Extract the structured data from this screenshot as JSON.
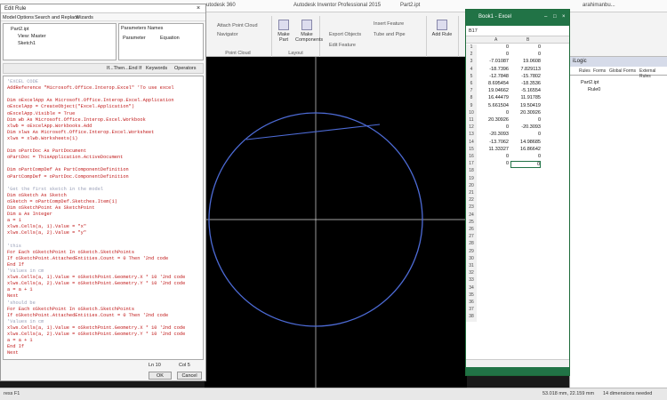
{
  "inventor": {
    "title": "Autodesk Inventor Professional 2015",
    "file": "Part2.ipt",
    "tab_fragment": "utodesk 360",
    "user": "arahimanbu...",
    "ribbon": {
      "buttons": [
        {
          "label": "Make Part"
        },
        {
          "label": "Make Components"
        },
        {
          "label": "Add Rule"
        }
      ],
      "small_items": [
        "Attach Point Cloud",
        "Navigator",
        "Point Cloud",
        "Export Objects",
        "Tube and Pipe",
        "Insert Feature",
        "Edit Feature"
      ],
      "groups": [
        "Point Cloud",
        "Layout",
        "iLogic"
      ]
    },
    "status": {
      "left": "ress F1",
      "coords": "53.018 mm, 22.159 mm",
      "dims": "14 dimensions needed"
    }
  },
  "ilogic_panel": {
    "title": "iLogic",
    "tabs": [
      "Rules",
      "Forms",
      "Global Forms",
      "External Rules"
    ],
    "tree": [
      "Part2.ipt",
      "Rule0"
    ]
  },
  "excel": {
    "title": "Book1 - Excel",
    "name_box": "B17",
    "columns": [
      "A",
      "B"
    ],
    "rows": [
      [
        "0",
        "0"
      ],
      [
        "0",
        "0"
      ],
      [
        "-7.01087",
        "19.0608"
      ],
      [
        "-18.7396",
        "7.829113"
      ],
      [
        "-12.7848",
        "-15.7802"
      ],
      [
        "8.695454",
        "-18.3536"
      ],
      [
        "19.04662",
        "-5.16554"
      ],
      [
        "16.44479",
        "11.91785"
      ],
      [
        "5.661504",
        "19.50419"
      ],
      [
        "0",
        "20.30926"
      ],
      [
        "20.30926",
        "0"
      ],
      [
        "0",
        "-20.3093"
      ],
      [
        "-20.3093",
        "0"
      ],
      [
        "-13.7062",
        "14.98685"
      ],
      [
        "11.33327",
        "16.86642"
      ],
      [
        "0",
        "0"
      ],
      [
        "0",
        "0"
      ]
    ],
    "extra_rows": [
      "18",
      "19",
      "20",
      "21",
      "22",
      "23",
      "24",
      "25",
      "26",
      "27",
      "28",
      "29",
      "30",
      "31",
      "32",
      "33",
      "34",
      "35",
      "36",
      "37",
      "38"
    ]
  },
  "editor": {
    "title": "Edit Rule",
    "menu": [
      "Model",
      "Options",
      "Search and Replace",
      "Wizards"
    ],
    "tree": [
      "Part2.ipt",
      "View: Master",
      "Sketch1"
    ],
    "params_tabs": [
      "Parameters",
      "Names"
    ],
    "params_cols": [
      "Parameter",
      "Equation"
    ],
    "toolbar": [
      "If...Then...End If",
      "Keywords",
      "Operators"
    ],
    "code": [
      {
        "t": "'EXCEL CODE",
        "c": "cm"
      },
      {
        "t": "AddReference \"Microsoft.Office.Interop.Excel\" 'To use excel",
        "c": "kw"
      },
      {
        "t": "",
        "c": "tx"
      },
      {
        "t": "Dim oExcelApp As Microsoft.Office.Interop.Excel.Application",
        "c": "kw"
      },
      {
        "t": "oExcelApp = CreateObject(\"Excel.Application\")",
        "c": "kw"
      },
      {
        "t": "oExcelApp.Visible = True",
        "c": "kw"
      },
      {
        "t": "Dim wb As Microsoft.Office.Interop.Excel.Workbook",
        "c": "kw"
      },
      {
        "t": "xlwb = oExcelApp.Workbooks.Add",
        "c": "kw"
      },
      {
        "t": "Dim xlws As Microsoft.Office.Interop.Excel.Worksheet",
        "c": "kw"
      },
      {
        "t": "xlws = xlwb.Worksheets(1)",
        "c": "kw"
      },
      {
        "t": "",
        "c": "tx"
      },
      {
        "t": "Dim oPartDoc As PartDocument",
        "c": "kw"
      },
      {
        "t": "oPartDoc = ThisApplication.ActiveDocument",
        "c": "kw"
      },
      {
        "t": "",
        "c": "tx"
      },
      {
        "t": "Dim oPartCompDef As PartComponentDefinition",
        "c": "kw"
      },
      {
        "t": "oPartCompDef = oPartDoc.ComponentDefinition",
        "c": "kw"
      },
      {
        "t": "",
        "c": "tx"
      },
      {
        "t": "'Get the first sketch in the model",
        "c": "cm"
      },
      {
        "t": "Dim oSketch As Sketch",
        "c": "kw"
      },
      {
        "t": "oSketch = oPartCompDef.Sketches.Item(1)",
        "c": "kw"
      },
      {
        "t": "Dim oSketchPoint As SketchPoint",
        "c": "kw"
      },
      {
        "t": "Dim a As Integer",
        "c": "kw"
      },
      {
        "t": "a = 1",
        "c": "kw"
      },
      {
        "t": "xlws.Cells(a, 1).Value = \"x\"",
        "c": "kw"
      },
      {
        "t": "xlws.Cells(a, 2).Value = \"y\"",
        "c": "kw"
      },
      {
        "t": "",
        "c": "tx"
      },
      {
        "t": "'this",
        "c": "cm"
      },
      {
        "t": "For Each oSketchPoint In oSketch.SketchPoints",
        "c": "kw"
      },
      {
        "t": "If oSketchPoint.AttachedEntities.Count = 0 Then '2nd code",
        "c": "kw"
      },
      {
        "t": "End If",
        "c": "kw"
      },
      {
        "t": "'Values in cm",
        "c": "cm"
      },
      {
        "t": "xlws.Cells(a, 1).Value = oSketchPoint.Geometry.X * 10 '2nd code",
        "c": "kw"
      },
      {
        "t": "xlws.Cells(a, 2).Value = oSketchPoint.Geometry.Y * 10 '2nd code",
        "c": "kw"
      },
      {
        "t": "a = a + 1",
        "c": "kw"
      },
      {
        "t": "Next",
        "c": "kw"
      },
      {
        "t": "'should be",
        "c": "cm"
      },
      {
        "t": "For Each oSketchPoint In oSketch.SketchPoints",
        "c": "kw"
      },
      {
        "t": "If oSketchPoint.AttachedEntities.Count = 0 Then '2nd code",
        "c": "kw"
      },
      {
        "t": "'Values in cm",
        "c": "cm"
      },
      {
        "t": "xlws.Cells(a, 1).Value = oSketchPoint.Geometry.X * 10 '2nd code",
        "c": "kw"
      },
      {
        "t": "xlws.Cells(a, 2).Value = oSketchPoint.Geometry.Y * 10 '2nd code",
        "c": "kw"
      },
      {
        "t": "a = a + 1",
        "c": "kw"
      },
      {
        "t": "End If",
        "c": "kw"
      },
      {
        "t": "Next",
        "c": "kw"
      }
    ],
    "ln": "Ln 10",
    "col": "Col 5",
    "ok": "OK",
    "cancel": "Cancel"
  }
}
